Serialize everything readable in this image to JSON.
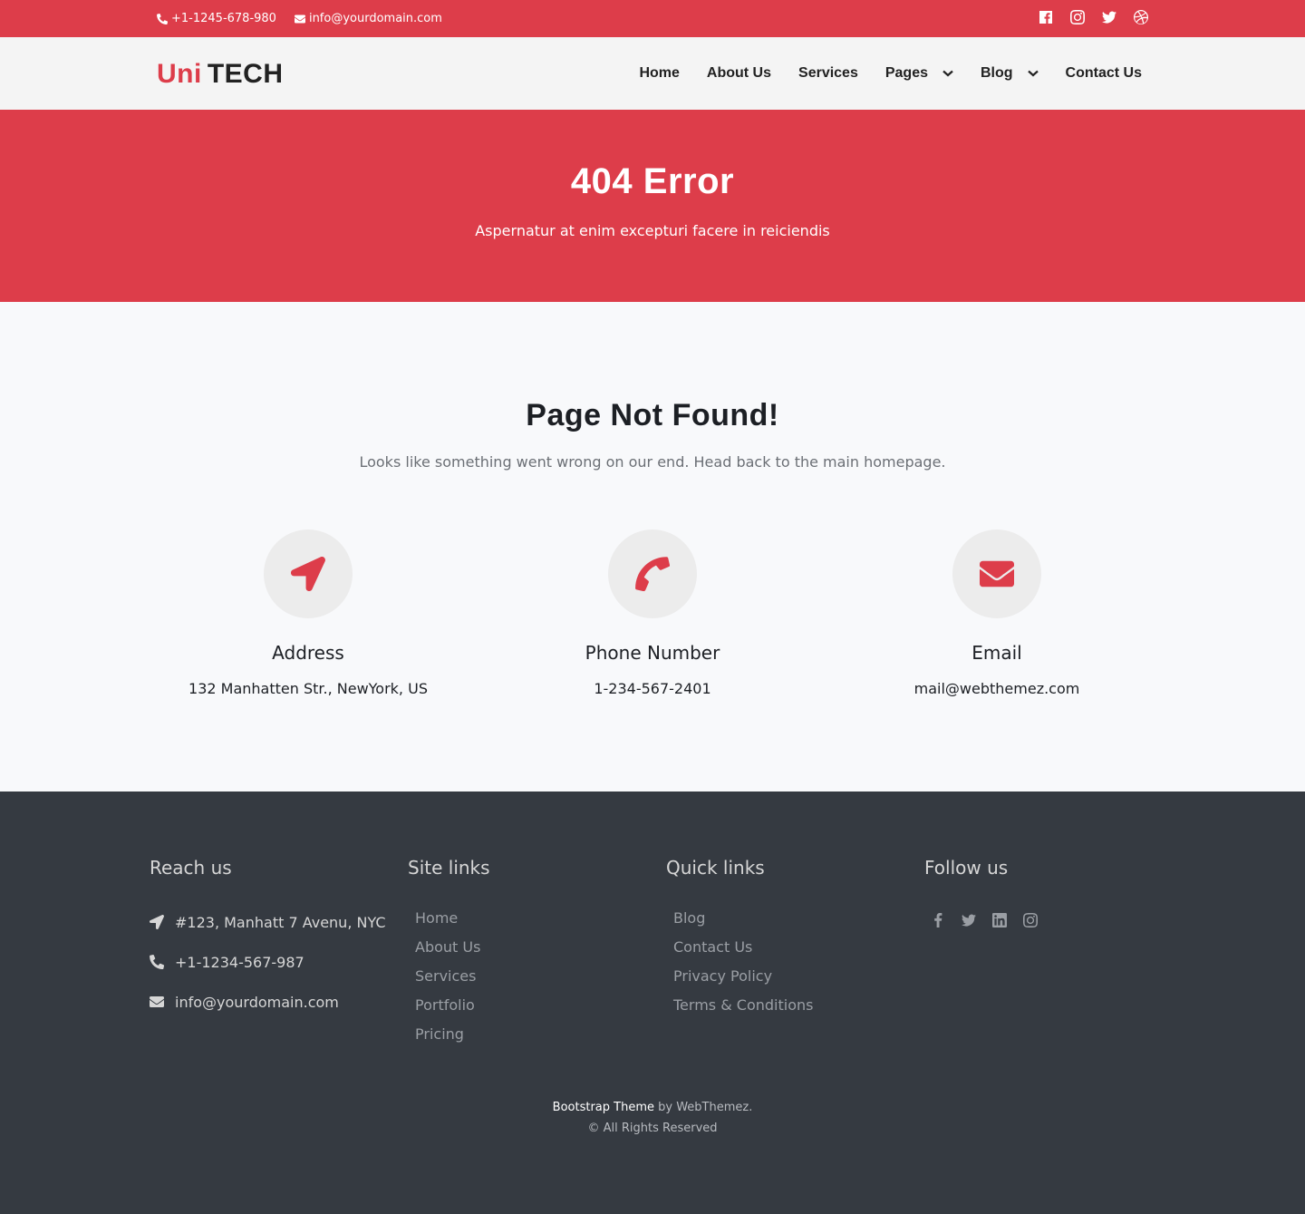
{
  "topbar": {
    "phone": "+1-1245-678-980",
    "email": "info@yourdomain.com",
    "social": [
      "facebook-icon",
      "instagram-icon",
      "twitter-icon",
      "dribbble-icon"
    ]
  },
  "brand": {
    "part1": "Uni",
    "part2": "TECH"
  },
  "nav": {
    "items": [
      {
        "label": "Home",
        "dropdown": false
      },
      {
        "label": "About Us",
        "dropdown": false
      },
      {
        "label": "Services",
        "dropdown": false
      },
      {
        "label": "Pages",
        "dropdown": true
      },
      {
        "label": "Blog",
        "dropdown": true
      },
      {
        "label": "Contact Us",
        "dropdown": false
      }
    ]
  },
  "hero": {
    "title": "404 Error",
    "subtitle": "Aspernatur at enim excepturi facere in reiciendis"
  },
  "main": {
    "title": "Page Not Found!",
    "subtitle": "Looks like something went wrong on our end. Head back to the main homepage.",
    "cards": [
      {
        "icon": "location-arrow-icon",
        "title": "Address",
        "value": "132 Manhatten Str., NewYork, US"
      },
      {
        "icon": "phone-icon",
        "title": "Phone Number",
        "value": "1-234-567-2401"
      },
      {
        "icon": "envelope-icon",
        "title": "Email",
        "value": "mail@webthemez.com"
      }
    ]
  },
  "footer": {
    "reach": {
      "title": "Reach us",
      "address": "#123, Manhatt 7 Avenu, NYC",
      "phone": "+1-1234-567-987",
      "email": "info@yourdomain.com"
    },
    "site_links": {
      "title": "Site links",
      "items": [
        "Home",
        "About Us",
        "Services",
        "Portfolio",
        "Pricing"
      ]
    },
    "quick_links": {
      "title": "Quick links",
      "items": [
        "Blog",
        "Contact Us",
        "Privacy Policy",
        "Terms & Conditions"
      ]
    },
    "follow": {
      "title": "Follow us",
      "icons": [
        "facebook-icon",
        "twitter-icon",
        "linkedin-icon",
        "instagram-icon"
      ]
    },
    "credit_theme": "Bootstrap Theme",
    "credit_by": " by WebThemez.",
    "copyright": "© All Rights Reserved"
  },
  "colors": {
    "accent": "#dd3d4a",
    "footer_bg": "#353a41",
    "nav_bg": "#f4f4f4"
  }
}
